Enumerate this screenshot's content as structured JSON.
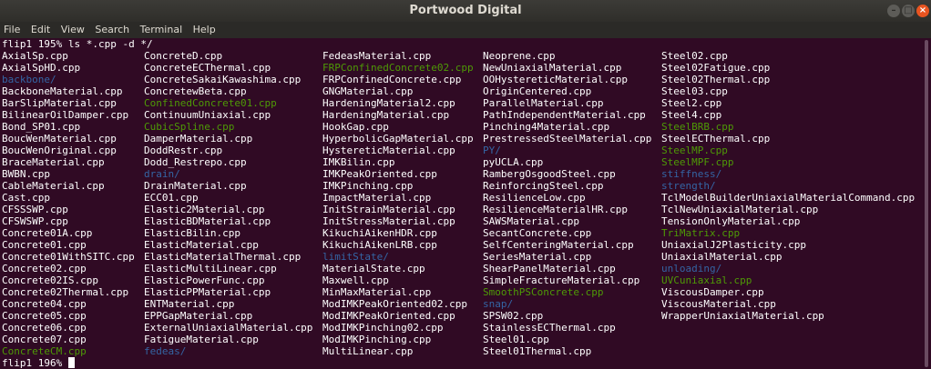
{
  "window": {
    "title": "Portwood Digital"
  },
  "menu": [
    "File",
    "Edit",
    "View",
    "Search",
    "Terminal",
    "Help"
  ],
  "terminal": {
    "command_line": "flip1 195% ls *.cpp -d */",
    "prompt_line": "flip1 196% ",
    "columns": [
      [
        {
          "name": "AxialSp.cpp",
          "type": "file"
        },
        {
          "name": "AxialSpHD.cpp",
          "type": "file"
        },
        {
          "name": "backbone/",
          "type": "dir"
        },
        {
          "name": "BackboneMaterial.cpp",
          "type": "file"
        },
        {
          "name": "BarSlipMaterial.cpp",
          "type": "file"
        },
        {
          "name": "BilinearOilDamper.cpp",
          "type": "file"
        },
        {
          "name": "Bond_SP01.cpp",
          "type": "file"
        },
        {
          "name": "BoucWenMaterial.cpp",
          "type": "file"
        },
        {
          "name": "BoucWenOriginal.cpp",
          "type": "file"
        },
        {
          "name": "BraceMaterial.cpp",
          "type": "file"
        },
        {
          "name": "BWBN.cpp",
          "type": "file"
        },
        {
          "name": "CableMaterial.cpp",
          "type": "file"
        },
        {
          "name": "Cast.cpp",
          "type": "file"
        },
        {
          "name": "CFSSSWP.cpp",
          "type": "file"
        },
        {
          "name": "CFSWSWP.cpp",
          "type": "file"
        },
        {
          "name": "Concrete01A.cpp",
          "type": "file"
        },
        {
          "name": "Concrete01.cpp",
          "type": "file"
        },
        {
          "name": "Concrete01WithSITC.cpp",
          "type": "file"
        },
        {
          "name": "Concrete02.cpp",
          "type": "file"
        },
        {
          "name": "Concrete02IS.cpp",
          "type": "file"
        },
        {
          "name": "Concrete02Thermal.cpp",
          "type": "file"
        },
        {
          "name": "Concrete04.cpp",
          "type": "file"
        },
        {
          "name": "Concrete05.cpp",
          "type": "file"
        },
        {
          "name": "Concrete06.cpp",
          "type": "file"
        },
        {
          "name": "Concrete07.cpp",
          "type": "file"
        },
        {
          "name": "ConcreteCM.cpp",
          "type": "exe"
        }
      ],
      [
        {
          "name": "ConcreteD.cpp",
          "type": "file"
        },
        {
          "name": "ConcreteECThermal.cpp",
          "type": "file"
        },
        {
          "name": "ConcreteSakaiKawashima.cpp",
          "type": "file"
        },
        {
          "name": "ConcretewBeta.cpp",
          "type": "file"
        },
        {
          "name": "ConfinedConcrete01.cpp",
          "type": "exe"
        },
        {
          "name": "ContinuumUniaxial.cpp",
          "type": "file"
        },
        {
          "name": "CubicSpline.cpp",
          "type": "exe"
        },
        {
          "name": "DamperMaterial.cpp",
          "type": "file"
        },
        {
          "name": "DoddRestr.cpp",
          "type": "file"
        },
        {
          "name": "Dodd_Restrepo.cpp",
          "type": "file"
        },
        {
          "name": "drain/",
          "type": "dir"
        },
        {
          "name": "DrainMaterial.cpp",
          "type": "file"
        },
        {
          "name": "ECC01.cpp",
          "type": "file"
        },
        {
          "name": "Elastic2Material.cpp",
          "type": "file"
        },
        {
          "name": "ElasticBDMaterial.cpp",
          "type": "file"
        },
        {
          "name": "ElasticBilin.cpp",
          "type": "file"
        },
        {
          "name": "ElasticMaterial.cpp",
          "type": "file"
        },
        {
          "name": "ElasticMaterialThermal.cpp",
          "type": "file"
        },
        {
          "name": "ElasticMultiLinear.cpp",
          "type": "file"
        },
        {
          "name": "ElasticPowerFunc.cpp",
          "type": "file"
        },
        {
          "name": "ElasticPPMaterial.cpp",
          "type": "file"
        },
        {
          "name": "ENTMaterial.cpp",
          "type": "file"
        },
        {
          "name": "EPPGapMaterial.cpp",
          "type": "file"
        },
        {
          "name": "ExternalUniaxialMaterial.cpp",
          "type": "file"
        },
        {
          "name": "FatigueMaterial.cpp",
          "type": "file"
        },
        {
          "name": "fedeas/",
          "type": "dir"
        }
      ],
      [
        {
          "name": "FedeasMaterial.cpp",
          "type": "file"
        },
        {
          "name": "FRPConfinedConcrete02.cpp",
          "type": "exe"
        },
        {
          "name": "FRPConfinedConcrete.cpp",
          "type": "file"
        },
        {
          "name": "GNGMaterial.cpp",
          "type": "file"
        },
        {
          "name": "HardeningMaterial2.cpp",
          "type": "file"
        },
        {
          "name": "HardeningMaterial.cpp",
          "type": "file"
        },
        {
          "name": "HookGap.cpp",
          "type": "file"
        },
        {
          "name": "HyperbolicGapMaterial.cpp",
          "type": "file"
        },
        {
          "name": "HystereticMaterial.cpp",
          "type": "file"
        },
        {
          "name": "IMKBilin.cpp",
          "type": "file"
        },
        {
          "name": "IMKPeakOriented.cpp",
          "type": "file"
        },
        {
          "name": "IMKPinching.cpp",
          "type": "file"
        },
        {
          "name": "ImpactMaterial.cpp",
          "type": "file"
        },
        {
          "name": "InitStrainMaterial.cpp",
          "type": "file"
        },
        {
          "name": "InitStressMaterial.cpp",
          "type": "file"
        },
        {
          "name": "KikuchiAikenHDR.cpp",
          "type": "file"
        },
        {
          "name": "KikuchiAikenLRB.cpp",
          "type": "file"
        },
        {
          "name": "limitState/",
          "type": "dir"
        },
        {
          "name": "MaterialState.cpp",
          "type": "file"
        },
        {
          "name": "Maxwell.cpp",
          "type": "file"
        },
        {
          "name": "MinMaxMaterial.cpp",
          "type": "file"
        },
        {
          "name": "ModIMKPeakOriented02.cpp",
          "type": "file"
        },
        {
          "name": "ModIMKPeakOriented.cpp",
          "type": "file"
        },
        {
          "name": "ModIMKPinching02.cpp",
          "type": "file"
        },
        {
          "name": "ModIMKPinching.cpp",
          "type": "file"
        },
        {
          "name": "MultiLinear.cpp",
          "type": "file"
        }
      ],
      [
        {
          "name": "Neoprene.cpp",
          "type": "file"
        },
        {
          "name": "NewUniaxialMaterial.cpp",
          "type": "file"
        },
        {
          "name": "OOHystereticMaterial.cpp",
          "type": "file"
        },
        {
          "name": "OriginCentered.cpp",
          "type": "file"
        },
        {
          "name": "ParallelMaterial.cpp",
          "type": "file"
        },
        {
          "name": "PathIndependentMaterial.cpp",
          "type": "file"
        },
        {
          "name": "Pinching4Material.cpp",
          "type": "file"
        },
        {
          "name": "PrestressedSteelMaterial.cpp",
          "type": "file"
        },
        {
          "name": "PY/",
          "type": "dir"
        },
        {
          "name": "pyUCLA.cpp",
          "type": "file"
        },
        {
          "name": "RambergOsgoodSteel.cpp",
          "type": "file"
        },
        {
          "name": "ReinforcingSteel.cpp",
          "type": "file"
        },
        {
          "name": "ResilienceLow.cpp",
          "type": "file"
        },
        {
          "name": "ResilienceMaterialHR.cpp",
          "type": "file"
        },
        {
          "name": "SAWSMaterial.cpp",
          "type": "file"
        },
        {
          "name": "SecantConcrete.cpp",
          "type": "file"
        },
        {
          "name": "SelfCenteringMaterial.cpp",
          "type": "file"
        },
        {
          "name": "SeriesMaterial.cpp",
          "type": "file"
        },
        {
          "name": "ShearPanelMaterial.cpp",
          "type": "file"
        },
        {
          "name": "SimpleFractureMaterial.cpp",
          "type": "file"
        },
        {
          "name": "SmoothPSConcrete.cpp",
          "type": "exe"
        },
        {
          "name": "snap/",
          "type": "dir"
        },
        {
          "name": "SPSW02.cpp",
          "type": "file"
        },
        {
          "name": "StainlessECThermal.cpp",
          "type": "file"
        },
        {
          "name": "Steel01.cpp",
          "type": "file"
        },
        {
          "name": "Steel01Thermal.cpp",
          "type": "file"
        }
      ],
      [
        {
          "name": "Steel02.cpp",
          "type": "file"
        },
        {
          "name": "Steel02Fatigue.cpp",
          "type": "file"
        },
        {
          "name": "Steel02Thermal.cpp",
          "type": "file"
        },
        {
          "name": "Steel03.cpp",
          "type": "file"
        },
        {
          "name": "Steel2.cpp",
          "type": "file"
        },
        {
          "name": "Steel4.cpp",
          "type": "file"
        },
        {
          "name": "SteelBRB.cpp",
          "type": "exe"
        },
        {
          "name": "SteelECThermal.cpp",
          "type": "file"
        },
        {
          "name": "SteelMP.cpp",
          "type": "exe"
        },
        {
          "name": "SteelMPF.cpp",
          "type": "exe"
        },
        {
          "name": "stiffness/",
          "type": "dir"
        },
        {
          "name": "strength/",
          "type": "dir"
        },
        {
          "name": "TclModelBuilderUniaxialMaterialCommand.cpp",
          "type": "file"
        },
        {
          "name": "TclNewUniaxialMaterial.cpp",
          "type": "file"
        },
        {
          "name": "TensionOnlyMaterial.cpp",
          "type": "file"
        },
        {
          "name": "TriMatrix.cpp",
          "type": "exe"
        },
        {
          "name": "UniaxialJ2Plasticity.cpp",
          "type": "file"
        },
        {
          "name": "UniaxialMaterial.cpp",
          "type": "file"
        },
        {
          "name": "unloading/",
          "type": "dir"
        },
        {
          "name": "UVCuniaxial.cpp",
          "type": "exe"
        },
        {
          "name": "ViscousDamper.cpp",
          "type": "file"
        },
        {
          "name": "ViscousMaterial.cpp",
          "type": "file"
        },
        {
          "name": "WrapperUniaxialMaterial.cpp",
          "type": "file"
        }
      ]
    ]
  },
  "colors": {
    "background": "#300a24",
    "file": "#ffffff",
    "dir": "#3465a4",
    "exe": "#4e9a06"
  }
}
